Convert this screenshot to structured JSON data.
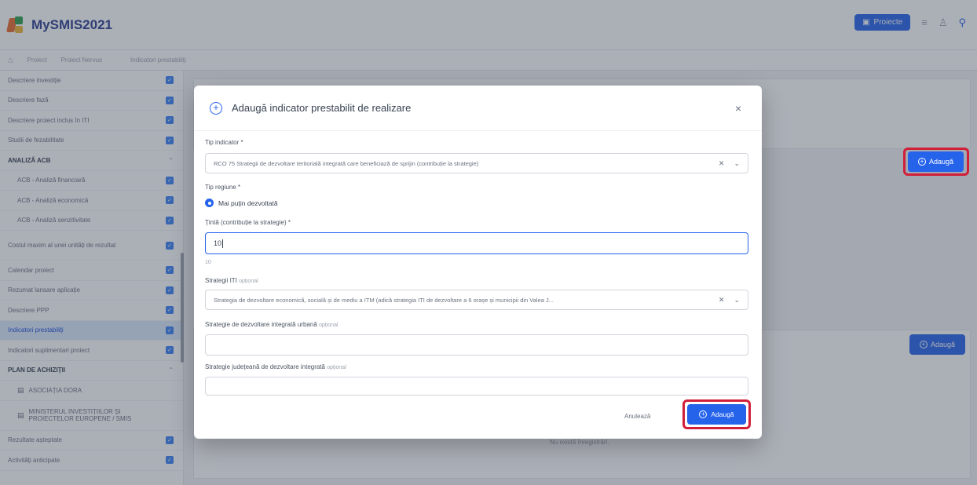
{
  "app": {
    "title": "MySMIS2021"
  },
  "topbar": {
    "projects_button": "Proiecte",
    "projects_icon": "folder-icon",
    "icons": [
      "menu-icon",
      "user-icon",
      "notification-icon"
    ]
  },
  "breadcrumb": {
    "items": [
      "Proiect",
      "Proiect Nervus",
      "Indicatori prestabiliți"
    ]
  },
  "sidebar": {
    "items": [
      {
        "label": "Descriere investiție"
      },
      {
        "label": "Descriere fază"
      },
      {
        "label": "Descriere proiect inclus în ITI"
      },
      {
        "label": "Studii de fezabilitate"
      },
      {
        "label": "ANALIZĂ ACB"
      },
      {
        "label": "ACB - Analiză financiară"
      },
      {
        "label": "ACB - Analiză economică"
      },
      {
        "label": "ACB - Analiză senzitivitate"
      },
      {
        "label": "Costul maxim al unei unități de rezultat"
      },
      {
        "label": "Calendar proiect"
      },
      {
        "label": "Rezumat lansare aplicație"
      },
      {
        "label": "Descriere PPP"
      },
      {
        "label": "Indicatori prestabiliți"
      },
      {
        "label": "Indicatori suplimentari proiect"
      },
      {
        "label": "PLAN DE ACHIZIȚII"
      },
      {
        "label": "ASOCIAȚIA DORA"
      },
      {
        "label": "MINISTERUL INVESTIȚIILOR ȘI PROIECTELOR EUROPENE / SMIS"
      },
      {
        "label": "Rezultate așteptate"
      },
      {
        "label": "Activități anticipate"
      }
    ]
  },
  "main": {
    "add_label": "Adaugă",
    "empty_text": "Nu există înregistrări."
  },
  "modal": {
    "title": "Adaugă indicator prestabilit de realizare",
    "close_label": "×",
    "tip_indicator": {
      "label": "Tip indicator *",
      "value": "RCO 75 Strategii de dezvoltare teritorială integrată care beneficiază de sprijin (contribuție la strategie)"
    },
    "tip_regiune": {
      "label": "Tip regiune *",
      "option": "Mai puțin dezvoltată"
    },
    "tinta": {
      "label": "Țintă (contribuție la strategie) *",
      "value": "10",
      "hint": "10"
    },
    "strategii_iti": {
      "label": "Strategii ITI",
      "optional": "opțional",
      "value": "Strategia de dezvoltare economică, socială și de mediu a ITM (adică strategia ITI de dezvoltare a 6 orașe și municipii din Valea J..."
    },
    "strategie_urbana": {
      "label": "Strategie de dezvoltare integrată urbană",
      "optional": "opțional"
    },
    "strategie_judeteana": {
      "label": "Strategie județeană de dezvoltare integrată",
      "optional": "opțional"
    },
    "cancel_label": "Anulează",
    "add_label": "Adaugă"
  },
  "colors": {
    "accent": "#2563eb",
    "highlight": "#d11f3a"
  }
}
